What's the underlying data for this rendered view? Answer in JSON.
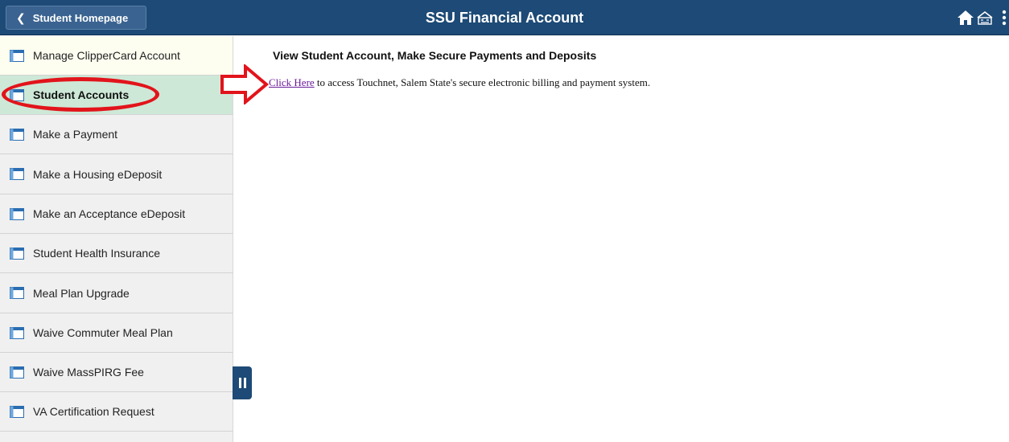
{
  "header": {
    "back_label": "Student Homepage",
    "title": "SSU Financial Account",
    "bg_color": "#1d4a76",
    "icons": [
      "home-icon",
      "nav-bar-icon",
      "actions-menu-icon"
    ]
  },
  "sidebar": {
    "items": [
      {
        "label": "Manage ClipperCard Account",
        "icon": "component-icon"
      },
      {
        "label": "Student Accounts",
        "icon": "component-icon",
        "selected": true
      },
      {
        "label": "Make a Payment",
        "icon": "component-icon"
      },
      {
        "label": "Make a Housing eDeposit",
        "icon": "component-icon"
      },
      {
        "label": "Make an Acceptance eDeposit",
        "icon": "component-icon"
      },
      {
        "label": "Student Health Insurance",
        "icon": "component-icon"
      },
      {
        "label": "Meal Plan Upgrade",
        "icon": "component-icon"
      },
      {
        "label": "Waive Commuter Meal Plan",
        "icon": "component-icon"
      },
      {
        "label": "Waive MassPIRG Fee",
        "icon": "component-icon"
      },
      {
        "label": "VA Certification Request",
        "icon": "component-icon"
      }
    ],
    "selected_color": "#cde8d7"
  },
  "main": {
    "heading": "View Student Account, Make Secure Payments and Deposits",
    "link_text": "Click Here",
    "link_color": "#6a1b9a",
    "body_text": " to access Touchnet, Salem State's secure electronic billing and payment system."
  },
  "annotations": {
    "color": "#e2141b",
    "shapes": [
      "ellipse-around-student-accounts",
      "arrow-to-click-here"
    ]
  }
}
